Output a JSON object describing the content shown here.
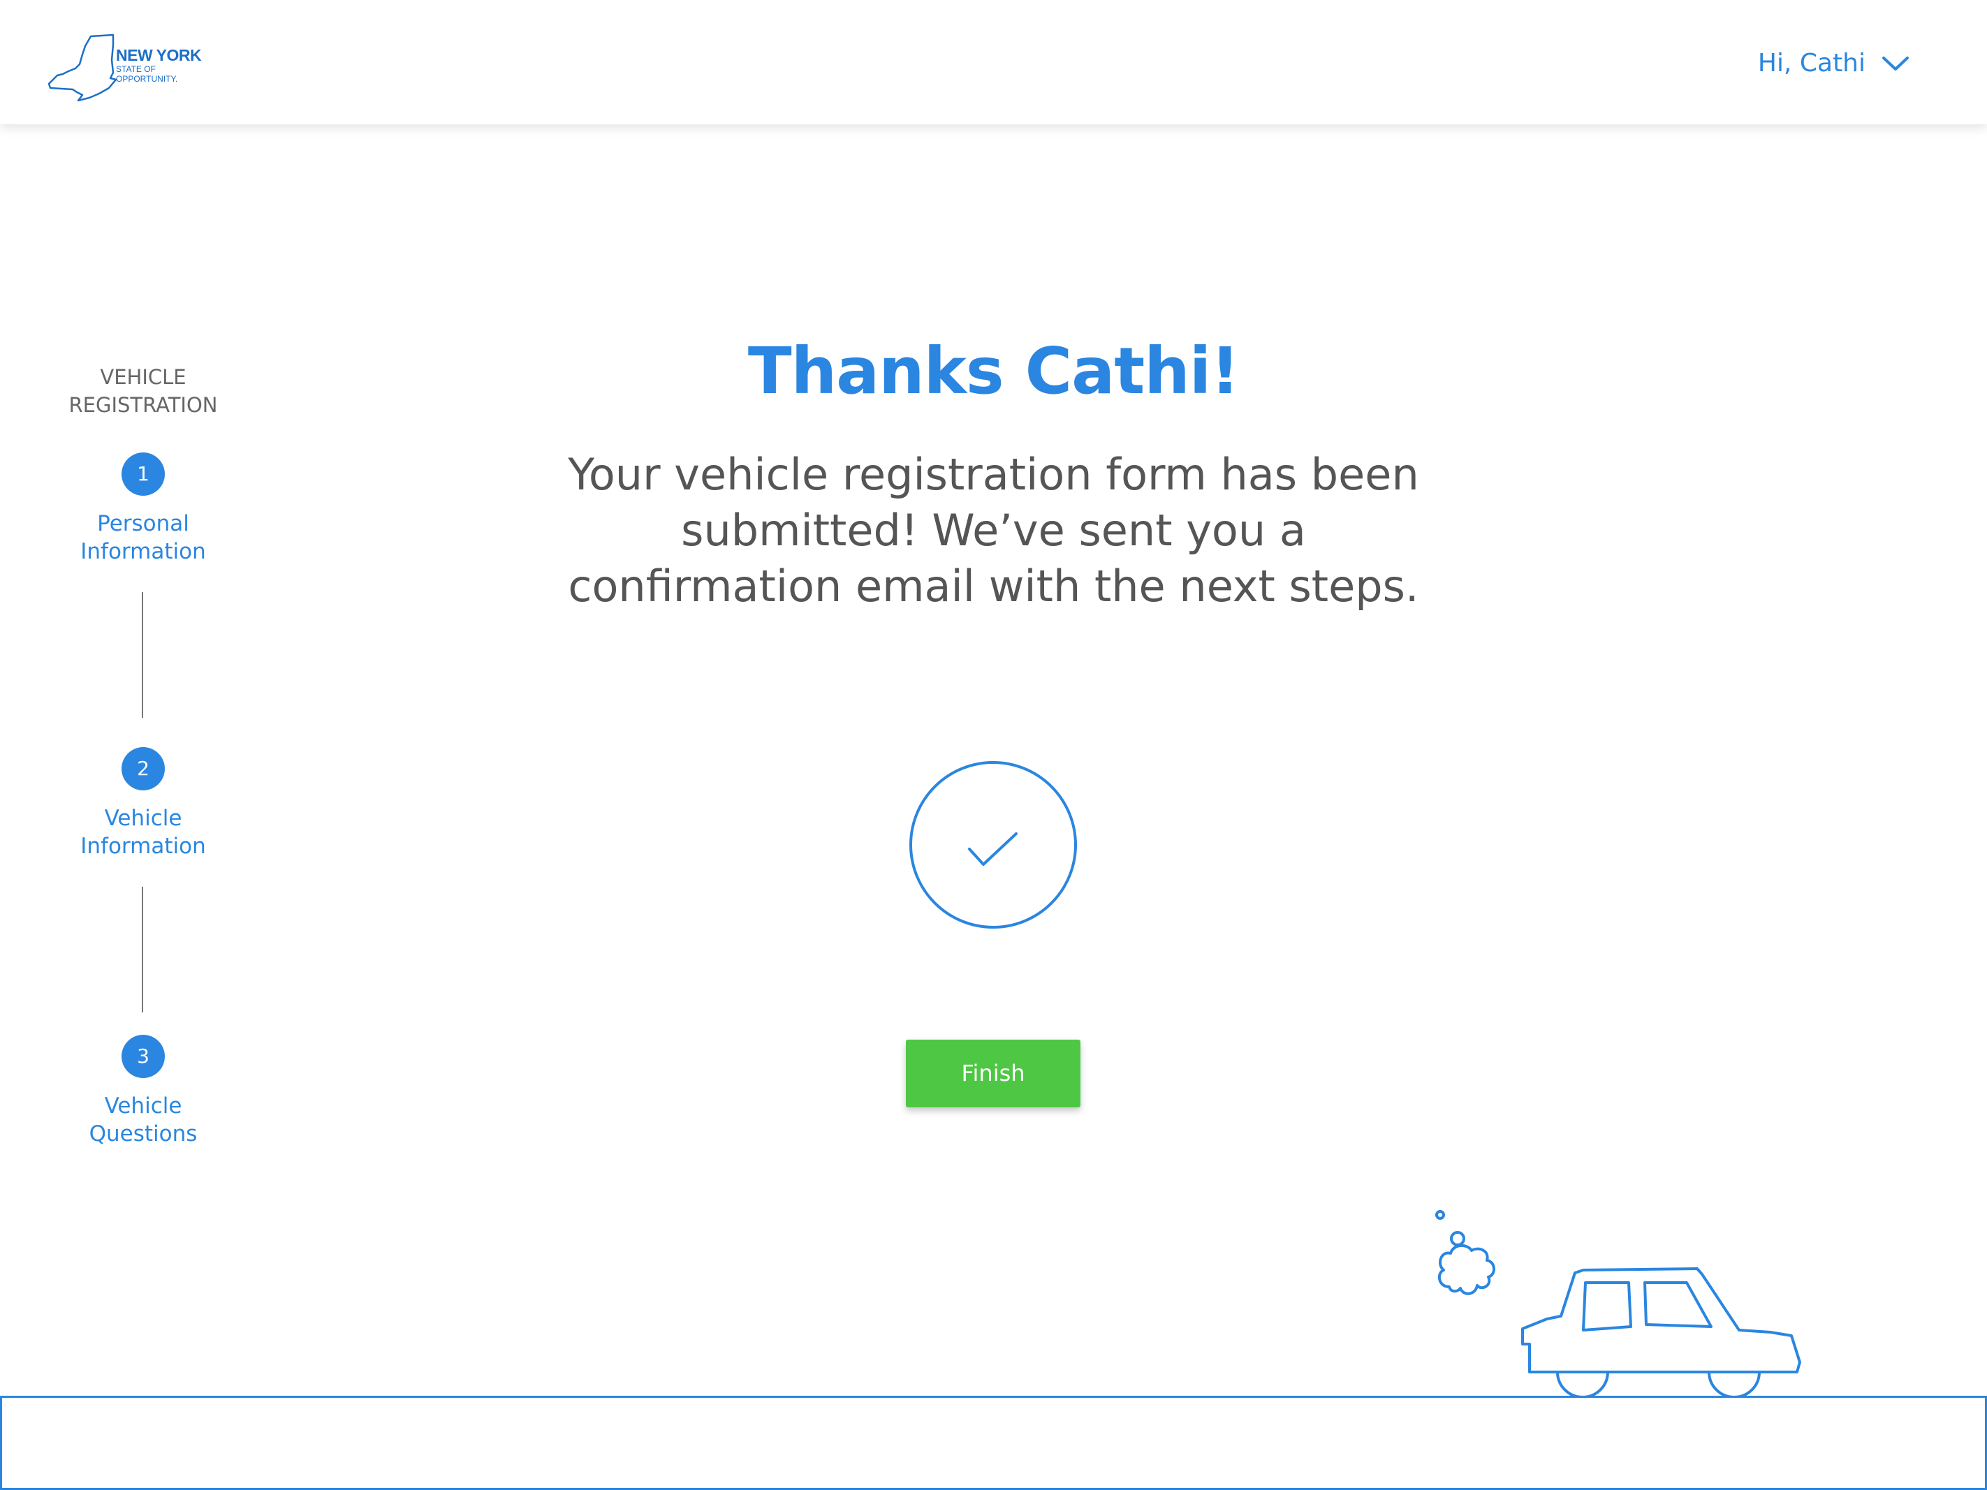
{
  "header": {
    "logo": {
      "line1": "NEW YORK",
      "line2": "STATE OF",
      "line3": "OPPORTUNITY.",
      "icon": "new-york-state-outline-icon"
    },
    "user_menu": {
      "greeting": "Hi, Cathi",
      "icon": "chevron-down-icon"
    }
  },
  "sidebar": {
    "title": "VEHICLE REGISTRATION",
    "steps": [
      {
        "number": "1",
        "label": "Personal Information"
      },
      {
        "number": "2",
        "label": "Vehicle Information"
      },
      {
        "number": "3",
        "label": "Vehicle Questions"
      }
    ]
  },
  "main": {
    "title": "Thanks Cathi!",
    "message": "Your vehicle registration form has been submitted! We’ve sent you a confirmation email with the next steps.",
    "status_icon": "checkmark-circle-icon",
    "finish_label": "Finish"
  },
  "illustration": {
    "icon": "car-with-exhaust-icon"
  },
  "colors": {
    "primary_blue": "#2a86e0",
    "logo_blue": "#1c6fc7",
    "finish_green": "#4ec744",
    "body_text": "#555555",
    "muted_text": "#666666"
  }
}
